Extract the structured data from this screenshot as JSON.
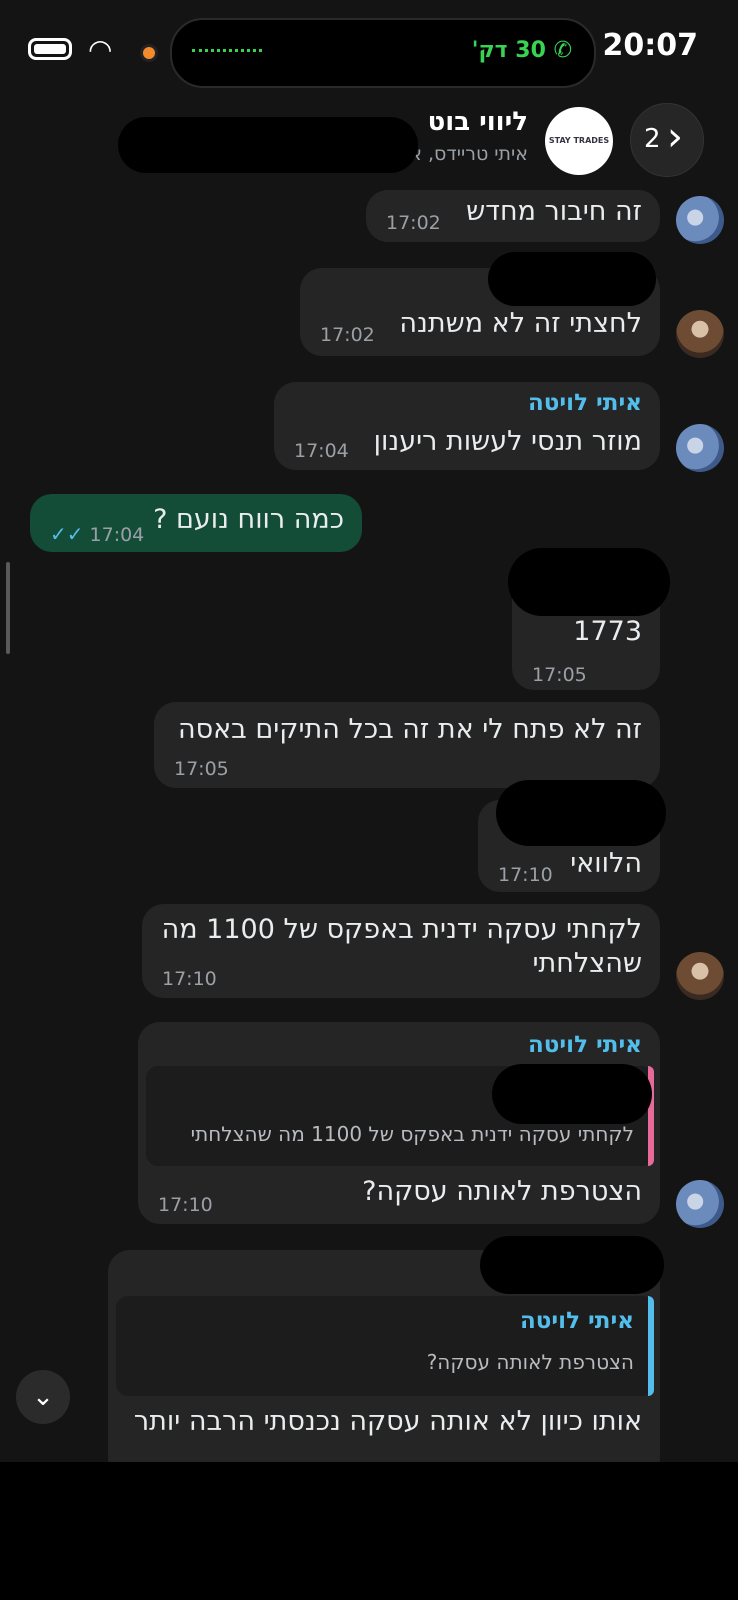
{
  "status_bar": {
    "time": "20:07",
    "call_duration": "30 דק'",
    "icons": [
      "battery-icon",
      "wifi-icon",
      "phone-icon"
    ]
  },
  "header": {
    "back_count": "2",
    "chat_name": "ליווי בוט",
    "participants": "איתי טריידס, איתי",
    "avatar_text": "STAY TRADES"
  },
  "messages": [
    {
      "text": "זה חיבור מחדש",
      "time": "17:02"
    },
    {
      "text": "לחצתי זה לא משתנה",
      "time": "17:02"
    },
    {
      "sender": "איתי לויטה",
      "text": "מוזר תנסי לעשות ריענון",
      "time": "17:04"
    },
    {
      "text": "כמה רווח נועם ?",
      "time": "17:04",
      "outgoing": true
    },
    {
      "text": "1773",
      "time": "17:05"
    },
    {
      "text": "זה לא פתח לי את זה בכל התיקים באסה",
      "time": "17:05"
    },
    {
      "text": "הלוואי",
      "time": "17:10"
    },
    {
      "text_line1": "לקחתי עסקה ידנית באפקס של 1100 מה",
      "text_line2": "שהצלחתי",
      "time": "17:10"
    },
    {
      "sender": "איתי לויטה",
      "quote": "לקחתי עסקה ידנית באפקס של 1100 מה שהצלחתי",
      "text": "הצטרפת לאותה עסקה?",
      "time": "17:10"
    },
    {
      "quote_sender": "איתי לויטה",
      "quote": "הצטרפת לאותה עסקה?",
      "text": "אותו כיוון לא אותה עסקה נכנסתי הרבה יותר"
    }
  ],
  "colors": {
    "background": "#141414",
    "bubble_incoming": "#252525",
    "bubble_outgoing": "#134d37",
    "sender_name": "#53bdeb",
    "call_green": "#39d353",
    "quote_pink": "#e86a9a",
    "quote_blue": "#53bdeb"
  }
}
